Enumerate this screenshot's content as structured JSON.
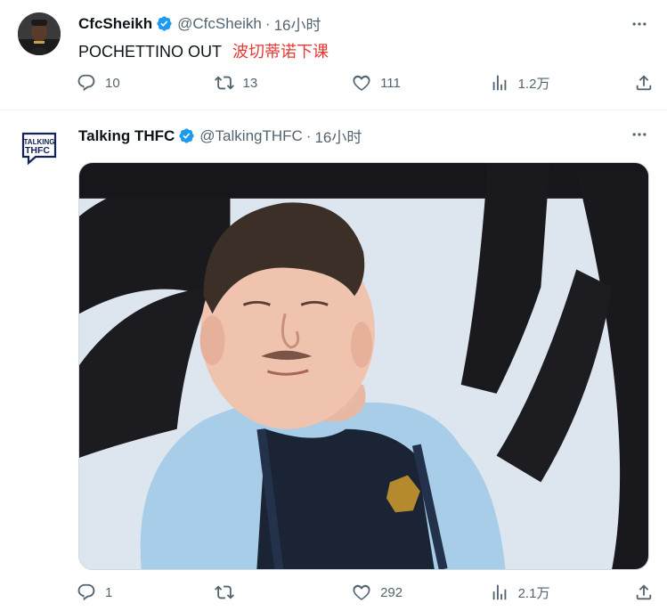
{
  "tweets": [
    {
      "author_name": "CfcSheikh",
      "handle": "@CfcSheikh",
      "separator": "·",
      "time": "16小时",
      "text_en": "POCHETTINO OUT",
      "text_cn": "波切蒂诺下课",
      "replies": "10",
      "retweets": "13",
      "likes": "111",
      "views": "1.2万"
    },
    {
      "author_name": "Talking THFC",
      "handle": "@TalkingTHFC",
      "separator": "·",
      "time": "16小时",
      "logo_line1": "TALKING",
      "logo_line2": "THFC",
      "replies": "1",
      "retweets": "",
      "likes": "292",
      "views": "2.1万"
    }
  ],
  "colors": {
    "verified": "#1d9bf0",
    "secondary_text": "#536471",
    "chinese_text": "#e53935"
  },
  "icons": [
    "verified-badge-icon",
    "more-icon",
    "reply-icon",
    "retweet-icon",
    "like-icon",
    "views-icon",
    "share-icon"
  ]
}
